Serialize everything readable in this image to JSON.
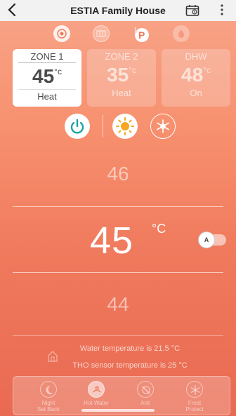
{
  "header": {
    "back_icon": "chevron-left-icon",
    "title": "ESTIA Family House",
    "calendar_icon": "calendar-icon",
    "menu_icon": "kebab-menu-icon"
  },
  "modes": [
    {
      "icon": "heat-pump-icon",
      "state": "active"
    },
    {
      "icon": "radiator-icon",
      "state": "inactive"
    },
    {
      "icon": "priority-icon",
      "state": "active",
      "label": "1P"
    },
    {
      "icon": "water-drop-icon",
      "state": "inactive"
    }
  ],
  "zones": [
    {
      "name": "ZONE 1",
      "value": "45",
      "unit": "°c",
      "mode": "Heat",
      "active": true
    },
    {
      "name": "ZONE 2",
      "value": "35",
      "unit": "°c",
      "mode": "Heat",
      "active": false
    },
    {
      "name": "DHW",
      "value": "48",
      "unit": "°c",
      "mode": "On",
      "active": false
    }
  ],
  "controls": {
    "power_icon": "power-icon",
    "heat_icon": "sun-icon",
    "cool_icon": "snowflake-icon"
  },
  "temperature": {
    "above": "46",
    "current": "45",
    "unit": "°C",
    "below": "44",
    "auto_label": "A"
  },
  "info": {
    "water_temp": "Water temperature is 21.5 °C",
    "tho_sensor": "THO sensor temperature is 25 °C"
  },
  "bottom_bar": [
    {
      "label": "Night\nSet Back",
      "icon": "moon-icon"
    },
    {
      "label": "Hot Water",
      "icon": "hot-water-icon"
    },
    {
      "label": "Anti",
      "icon": "anti-bacteria-icon"
    },
    {
      "label": "Frost\nProtect",
      "icon": "frost-protect-icon"
    }
  ],
  "colors": {
    "accent_teal": "#1aa3a3",
    "accent_orange": "#f5a623",
    "background_top": "#f8a58a",
    "background_bottom": "#e96a52"
  }
}
